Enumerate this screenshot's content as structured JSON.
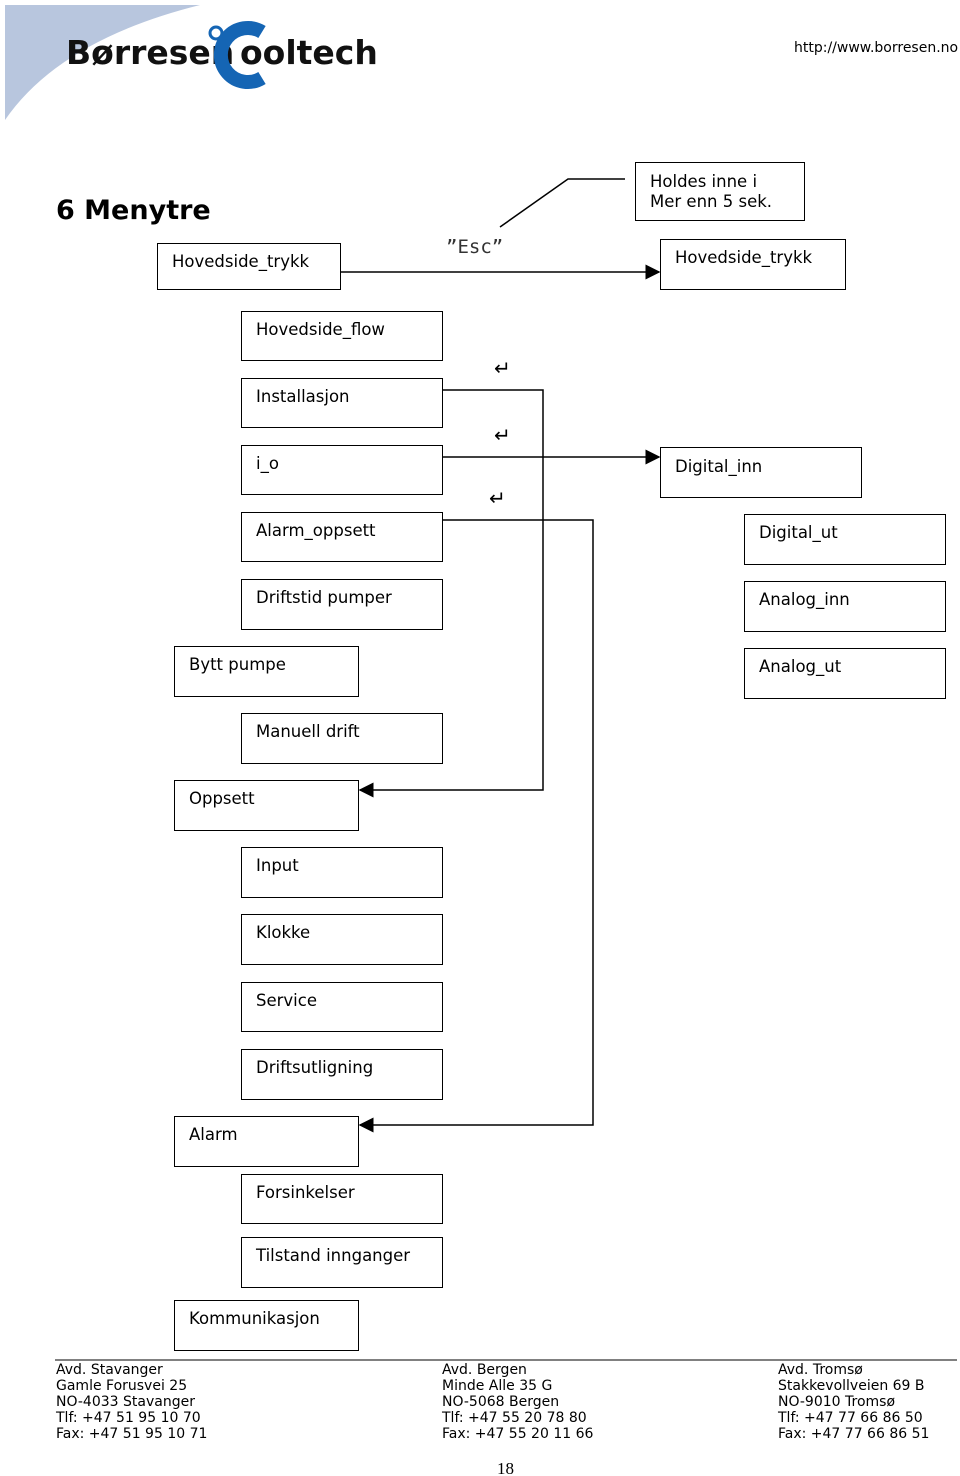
{
  "header": {
    "logo_text": "Børresen Cooltech",
    "url": "http://www.borresen.no",
    "colors": {
      "brand_blue": "#1565b4",
      "swoosh": "#b8c6de"
    }
  },
  "title": "6 Menytre",
  "note": {
    "line1": "Holdes inne i",
    "line2": "Mer enn 5 sek."
  },
  "esc_label": "”Esc”",
  "return_icon": "↵",
  "boxes": {
    "hovedside_trykk_left": "Hovedside_trykk",
    "hovedside_trykk_right": "Hovedside_trykk",
    "hovedside_flow": "Hovedside_flow",
    "installasjon": "Installasjon",
    "i_o": "i_o",
    "alarm_oppsett": "Alarm_oppsett",
    "driftstid_pumper": "Driftstid pumper",
    "bytt_pumpe": "Bytt pumpe",
    "manuell_drift": "Manuell drift",
    "oppsett": "Oppsett",
    "input": "Input",
    "klokke": "Klokke",
    "service": "Service",
    "driftsutligning": "Driftsutligning",
    "alarm": "Alarm",
    "forsinkelser": "Forsinkelser",
    "tilstand_innganger": "Tilstand innganger",
    "kommunikasjon": "Kommunikasjon",
    "digital_inn": "Digital_inn",
    "digital_ut": "Digital_ut",
    "analog_inn": "Analog_inn",
    "analog_ut": "Analog_ut"
  },
  "footer": [
    {
      "name": "Avd. Stavanger",
      "street": "Gamle Forusvei 25",
      "city": "NO-4033 Stavanger",
      "tlf": "Tlf: +47 51 95 10 70",
      "fax": "Fax: +47 51 95 10 71"
    },
    {
      "name": "Avd. Bergen",
      "street": "Minde Alle 35 G",
      "city": "NO-5068 Bergen",
      "tlf": "Tlf: +47 55 20 78 80",
      "fax": "Fax: +47 55 20 11 66"
    },
    {
      "name": "Avd. Tromsø",
      "street": "Stakkevollveien 69 B",
      "city": "NO-9010 Tromsø",
      "tlf": "Tlf: +47 77 66 86 50",
      "fax": "Fax: +47 77 66 86 51"
    }
  ],
  "page_number": "18"
}
